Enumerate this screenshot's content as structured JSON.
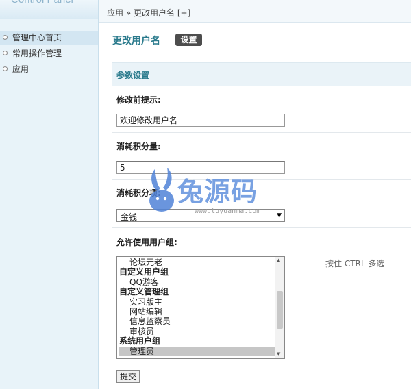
{
  "sidebar": {
    "title": "Control Panel",
    "items": [
      {
        "label": "管理中心首页"
      },
      {
        "label": "常用操作管理"
      },
      {
        "label": "应用"
      }
    ]
  },
  "breadcrumb": {
    "root": "应用",
    "sep": "»",
    "current": "更改用户名",
    "add": "[+]"
  },
  "page": {
    "title": "更改用户名",
    "tab": "设置"
  },
  "section": {
    "title": "参数设置"
  },
  "fields": {
    "hint_label": "修改前提示:",
    "hint_value": "欢迎修改用户名",
    "credit_label": "消耗积分量:",
    "credit_value": "5",
    "credit_type_label": "消耗积分项:",
    "credit_type_value": "金钱",
    "groups_label": "允许使用用户组:",
    "groups_hint": "按住 CTRL 多选"
  },
  "group_options": [
    {
      "label": "论坛元老",
      "kind": "child",
      "selected": false
    },
    {
      "label": "自定义用户组",
      "kind": "group",
      "selected": false
    },
    {
      "label": "QQ游客",
      "kind": "child",
      "selected": false
    },
    {
      "label": "自定义管理组",
      "kind": "group",
      "selected": false
    },
    {
      "label": "实习版主",
      "kind": "child",
      "selected": false
    },
    {
      "label": "网站编辑",
      "kind": "child",
      "selected": false
    },
    {
      "label": "信息监察员",
      "kind": "child",
      "selected": false
    },
    {
      "label": "审核员",
      "kind": "child",
      "selected": false
    },
    {
      "label": "系统用户组",
      "kind": "group",
      "selected": false
    },
    {
      "label": "管理员",
      "kind": "child",
      "selected": true
    }
  ],
  "actions": {
    "submit": "提交"
  },
  "watermark": {
    "text": "兔源码",
    "url": "www.tuyuanma.com"
  },
  "colors": {
    "accent": "#2a7a8c",
    "sidebar_bg": "#e8f3f9",
    "tab_bg": "#4d4d4d"
  }
}
